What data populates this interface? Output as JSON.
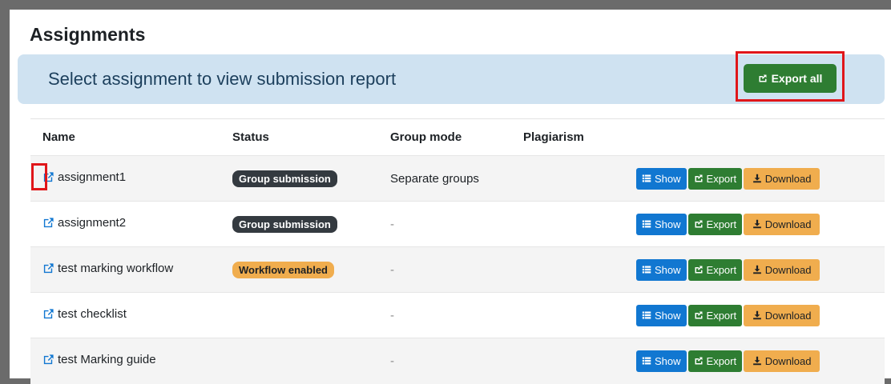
{
  "page": {
    "title": "Assignments",
    "banner_text": "Select assignment to view submission report",
    "export_all_label": "Export all"
  },
  "table": {
    "headers": {
      "name": "Name",
      "status": "Status",
      "group_mode": "Group mode",
      "plagiarism": "Plagiarism"
    },
    "rows": [
      {
        "name": "assignment1",
        "status": "Group submission",
        "status_style": "dark",
        "group_mode": "Separate groups",
        "plagiarism": ""
      },
      {
        "name": "assignment2",
        "status": "Group submission",
        "status_style": "dark",
        "group_mode": "-",
        "plagiarism": ""
      },
      {
        "name": "test marking workflow",
        "status": "Workflow enabled",
        "status_style": "warn",
        "group_mode": "-",
        "plagiarism": ""
      },
      {
        "name": "test checklist",
        "status": "",
        "status_style": "",
        "group_mode": "-",
        "plagiarism": ""
      },
      {
        "name": "test Marking guide",
        "status": "",
        "status_style": "",
        "group_mode": "-",
        "plagiarism": ""
      }
    ],
    "actions": {
      "show": "Show",
      "export": "Export",
      "download": "Download"
    }
  },
  "icons": {
    "external_link": "external-link-icon",
    "list": "list-icon",
    "share": "share-icon",
    "download": "download-icon"
  },
  "colors": {
    "banner_bg": "#cfe2f1",
    "export_green": "#2e7d32",
    "show_blue": "#1177d1",
    "download_orange": "#f0ad4e",
    "highlight_red": "#e0161a"
  }
}
